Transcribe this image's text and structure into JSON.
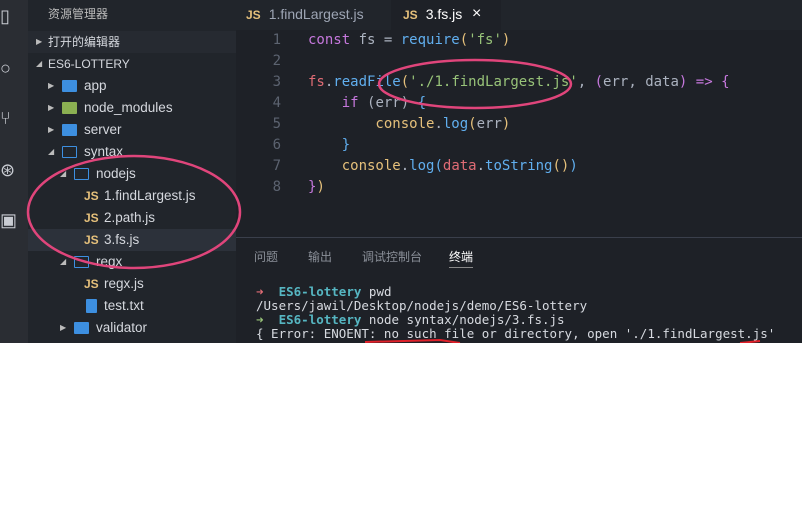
{
  "sidebar": {
    "title": "资源管理器",
    "open_editors": "打开的编辑器",
    "project": "ES6-LOTTERY",
    "items": [
      {
        "label": "app",
        "kind": "folder"
      },
      {
        "label": "node_modules",
        "kind": "folder-node"
      },
      {
        "label": "server",
        "kind": "folder"
      },
      {
        "label": "syntax",
        "kind": "folder-open"
      },
      {
        "label": "nodejs",
        "kind": "folder-open"
      },
      {
        "label": "1.findLargest.js",
        "kind": "js"
      },
      {
        "label": "2.path.js",
        "kind": "js"
      },
      {
        "label": "3.fs.js",
        "kind": "js"
      },
      {
        "label": "regx",
        "kind": "folder-open"
      },
      {
        "label": "regx.js",
        "kind": "js"
      },
      {
        "label": "test.txt",
        "kind": "file"
      },
      {
        "label": "validator",
        "kind": "folder"
      }
    ],
    "js_badge": "JS"
  },
  "tabs": [
    {
      "label": "1.findLargest.js"
    },
    {
      "label": "3.fs.js",
      "close": "×"
    }
  ],
  "code": [
    [
      [
        "const",
        "#c678dd"
      ],
      [
        " fs = ",
        "#abb2bf"
      ],
      [
        "require",
        "#61afef"
      ],
      [
        "(",
        "#e5c07b"
      ],
      [
        "'fs'",
        "#98c379"
      ],
      [
        ")",
        "#e5c07b"
      ]
    ],
    [],
    [
      [
        "fs",
        "#e06c75"
      ],
      [
        ".",
        "#abb2bf"
      ],
      [
        "readFile",
        "#61afef"
      ],
      [
        "(",
        "#e5c07b"
      ],
      [
        "'./1.findLargest.js'",
        "#98c379"
      ],
      [
        ", ",
        "#abb2bf"
      ],
      [
        "(",
        "#c678dd"
      ],
      [
        "err, data",
        "#abb2bf"
      ],
      [
        ")",
        "#c678dd"
      ],
      [
        " => ",
        "#c678dd"
      ],
      [
        "{",
        "#c678dd"
      ]
    ],
    [
      [
        "    if ",
        "#c678dd"
      ],
      [
        "(err) ",
        "#abb2bf"
      ],
      [
        "{",
        "#61afef"
      ]
    ],
    [
      [
        "        console",
        "#e5c07b"
      ],
      [
        ".",
        "#abb2bf"
      ],
      [
        "log",
        "#61afef"
      ],
      [
        "(",
        "#e5c07b"
      ],
      [
        "err",
        "#abb2bf"
      ],
      [
        ")",
        "#e5c07b"
      ]
    ],
    [
      [
        "    }",
        "#61afef"
      ]
    ],
    [
      [
        "    console",
        "#e5c07b"
      ],
      [
        ".",
        "#abb2bf"
      ],
      [
        "log",
        "#61afef"
      ],
      [
        "(",
        "#61afef"
      ],
      [
        "data",
        "#e06c75"
      ],
      [
        ".",
        "#abb2bf"
      ],
      [
        "toString",
        "#61afef"
      ],
      [
        "()",
        "#e5c07b"
      ],
      [
        ")",
        "#61afef"
      ]
    ],
    [
      [
        "}",
        "#c678dd"
      ],
      [
        ")",
        "#e5c07b"
      ]
    ]
  ],
  "panel": {
    "tabs": [
      "问题",
      "输出",
      "调试控制台",
      "终端"
    ],
    "terminal": {
      "prompt": "➜",
      "dir": "ES6-lottery",
      "cmd1": " pwd",
      "out1": "/Users/jawil/Desktop/nodejs/demo/ES6-lottery",
      "cmd2": " node syntax/nodejs/3.fs.js",
      "out2": "{ Error: ENOENT: no such file or directory, open './1.findLargest.js'"
    }
  },
  "colors": {
    "annotation": "#e0457b",
    "prompt_err": "#e06c75",
    "prompt_ok": "#98c379"
  }
}
